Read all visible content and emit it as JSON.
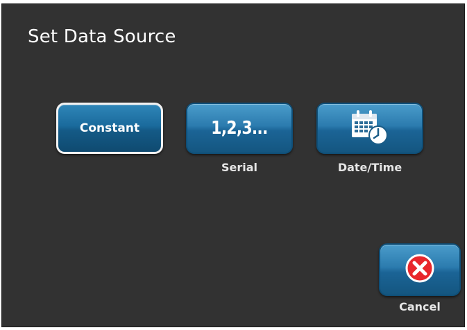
{
  "dialog": {
    "title": "Set Data Source"
  },
  "options": [
    {
      "label": "Constant",
      "caption": "",
      "icon": "text-label",
      "selected": true
    },
    {
      "label": "1,2,3...",
      "caption": "Serial",
      "icon": "serial-numbers-icon",
      "selected": false
    },
    {
      "label": "",
      "caption": "Date/Time",
      "icon": "calendar-clock-icon",
      "selected": false
    }
  ],
  "actions": {
    "cancel_label": "Cancel",
    "cancel_icon": "close-icon"
  },
  "colors": {
    "background": "#323232",
    "button_blue": "#2b7bae",
    "selected_border": "#f2f2f2",
    "cancel_red": "#e8262c"
  }
}
